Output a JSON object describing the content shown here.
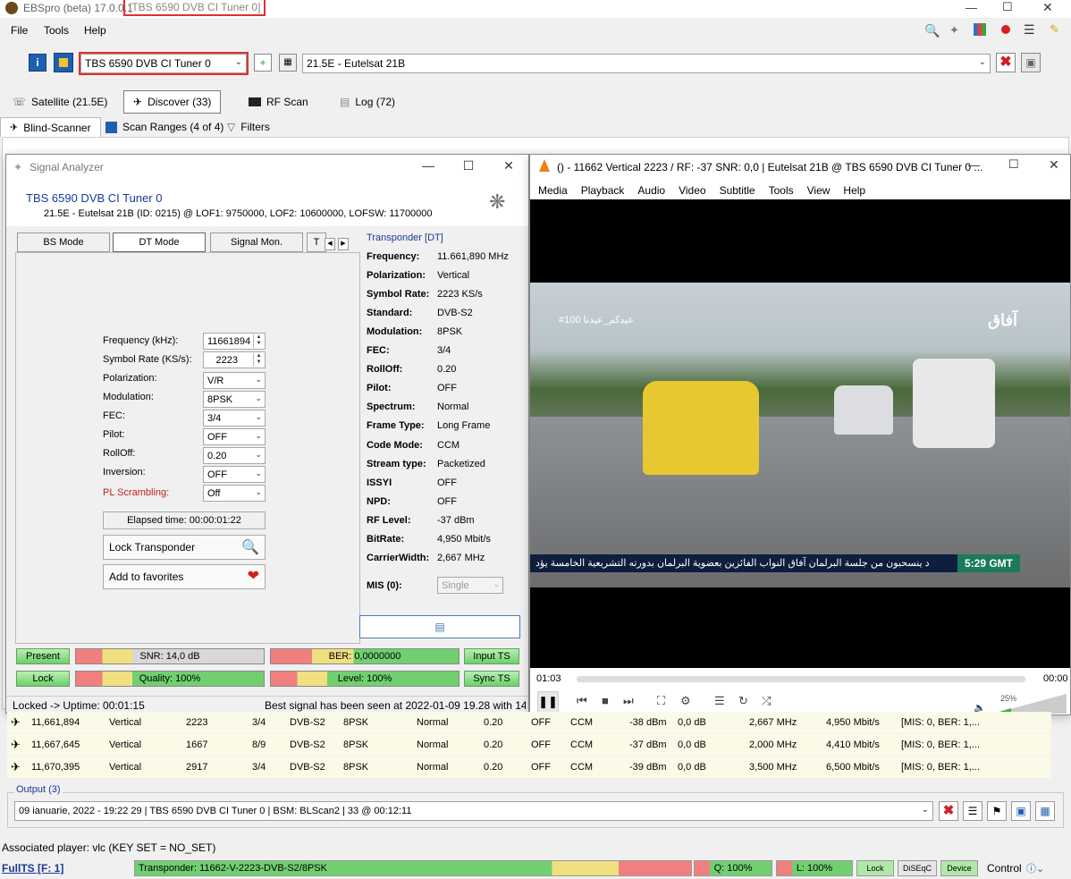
{
  "app": {
    "title": "EBSpro (beta) 17.0.0.1",
    "title_tuner": "[TBS 6590 DVB CI Tuner 0]",
    "menu": [
      "File",
      "Tools",
      "Help"
    ]
  },
  "toolbar": {
    "tuner": "TBS 6590 DVB CI Tuner 0",
    "satellite": "21.5E - Eutelsat 21B"
  },
  "tabs": [
    {
      "label": "Satellite (21.5E)"
    },
    {
      "label": "Discover (33)"
    },
    {
      "label": "RF Scan"
    },
    {
      "label": "Log (72)"
    }
  ],
  "subtabs": [
    {
      "label": "Blind-Scanner"
    },
    {
      "label": "Scan Ranges (4 of 4)"
    },
    {
      "label": "Filters"
    }
  ],
  "analyzer": {
    "title": "Signal Analyzer",
    "tuner": "TBS 6590 DVB CI Tuner 0",
    "info": "21.5E - Eutelsat 21B (ID: 0215) @ LOF1: 9750000, LOF2: 10600000, LOFSW: 11700000",
    "modes": [
      "BS Mode",
      "DT Mode",
      "Signal Mon.",
      "T"
    ],
    "fields": [
      {
        "label": "Frequency (kHz):",
        "value": "11661894"
      },
      {
        "label": "Symbol Rate (KS/s):",
        "value": "2223"
      },
      {
        "label": "Polarization:",
        "value": "V/R"
      },
      {
        "label": "Modulation:",
        "value": "8PSK"
      },
      {
        "label": "FEC:",
        "value": "3/4"
      },
      {
        "label": "Pilot:",
        "value": "OFF"
      },
      {
        "label": "RollOff:",
        "value": "0.20"
      },
      {
        "label": "Inversion:",
        "value": "OFF"
      },
      {
        "label": "PL Scrambling:",
        "value": "Off"
      }
    ],
    "elapsed": "Elapsed time: 00:00:01:22",
    "lock_transponder": "Lock Transponder",
    "add_favorites": "Add to favorites",
    "transponder_title": "Transponder [DT]",
    "transponder": [
      {
        "k": "Frequency:",
        "v": "11.661,890 MHz"
      },
      {
        "k": "Polarization:",
        "v": "Vertical"
      },
      {
        "k": "Symbol Rate:",
        "v": "2223 KS/s"
      },
      {
        "k": "Standard:",
        "v": "DVB-S2"
      },
      {
        "k": "Modulation:",
        "v": "8PSK"
      },
      {
        "k": "FEC:",
        "v": "3/4"
      },
      {
        "k": "RollOff:",
        "v": "0.20"
      },
      {
        "k": "Pilot:",
        "v": "OFF"
      },
      {
        "k": "Spectrum:",
        "v": "Normal"
      },
      {
        "k": "Frame Type:",
        "v": "Long Frame"
      },
      {
        "k": "Code Mode:",
        "v": "CCM"
      },
      {
        "k": "Stream type:",
        "v": "Packetized"
      },
      {
        "k": "ISSYI",
        "v": "OFF"
      },
      {
        "k": "NPD:",
        "v": "OFF"
      },
      {
        "k": "RF Level:",
        "v": "-37 dBm"
      },
      {
        "k": "BitRate:",
        "v": "4,950 Mbit/s"
      },
      {
        "k": "CarrierWidth:",
        "v": "2,667 MHz"
      }
    ],
    "mis_label": "MIS (0):",
    "mis_value": "Single",
    "indicators": {
      "present": "Present",
      "lock": "Lock",
      "snr": "SNR: 14,0 dB",
      "quality": "Quality: 100%",
      "ber": "BER: 0,0000000",
      "level": "Level: 100%",
      "input_ts": "Input TS",
      "sync_ts": "Sync TS"
    },
    "status_left": "Locked -> Uptime: 00:01:15",
    "status_right": "Best signal has been seen at 2022-01-09 19.28 with 14,"
  },
  "vlc": {
    "title": "() - 11662 Vertical 2223 / RF: -37 SNR: 0,0 | Eutelsat 21B @ TBS 6590 DVB CI Tuner 0 ...",
    "menu": [
      "Media",
      "Playback",
      "Audio",
      "Video",
      "Subtitle",
      "Tools",
      "View",
      "Help"
    ],
    "overlay_tag": "#100 عيدكم_عيدنا",
    "channel_logo": "آفاق",
    "ticker": "د ينسحبون من جلسة البرلمان   آفاق   النواب الفائزين بعضوية البرلمان بدورته التشريعية الخامسة يؤد",
    "clock": "5:29 GMT",
    "time_elapsed": "01:03",
    "time_total": "00:00",
    "volume": "25%"
  },
  "results": [
    [
      "11,661,894",
      "Vertical",
      "2223",
      "3/4",
      "DVB-S2",
      "8PSK",
      "Normal",
      "0.20",
      "OFF",
      "CCM",
      "-38 dBm",
      "0,0 dB",
      "2,667 MHz",
      "4,950 Mbit/s",
      "[MIS: 0, BER: 1,..."
    ],
    [
      "11,667,645",
      "Vertical",
      "1667",
      "8/9",
      "DVB-S2",
      "8PSK",
      "Normal",
      "0.20",
      "OFF",
      "CCM",
      "-37 dBm",
      "0,0 dB",
      "2,000 MHz",
      "4,410 Mbit/s",
      "[MIS: 0, BER: 1,..."
    ],
    [
      "11,670,395",
      "Vertical",
      "2917",
      "3/4",
      "DVB-S2",
      "8PSK",
      "Normal",
      "0.20",
      "OFF",
      "CCM",
      "-39 dBm",
      "0,0 dB",
      "3,500 MHz",
      "6,500 Mbit/s",
      "[MIS: 0, BER: 1,..."
    ]
  ],
  "output": {
    "title": "Output (3)",
    "value": "09 ianuarie, 2022 - 19:22 29 | TBS 6590 DVB CI Tuner 0 | BSM: BLScan2 | 33 @ 00:12:11"
  },
  "footer": {
    "associated": "Associated player: vlc (KEY SET = NO_SET)",
    "fullts": "FullTS [F: 1]",
    "transponder": "Transponder: 11662-V-2223-DVB-S2/8PSK",
    "q": "Q: 100%",
    "l": "L: 100%",
    "lock": "Lock",
    "diseqc": "DiSEqC",
    "device": "Device",
    "control": "Control"
  }
}
